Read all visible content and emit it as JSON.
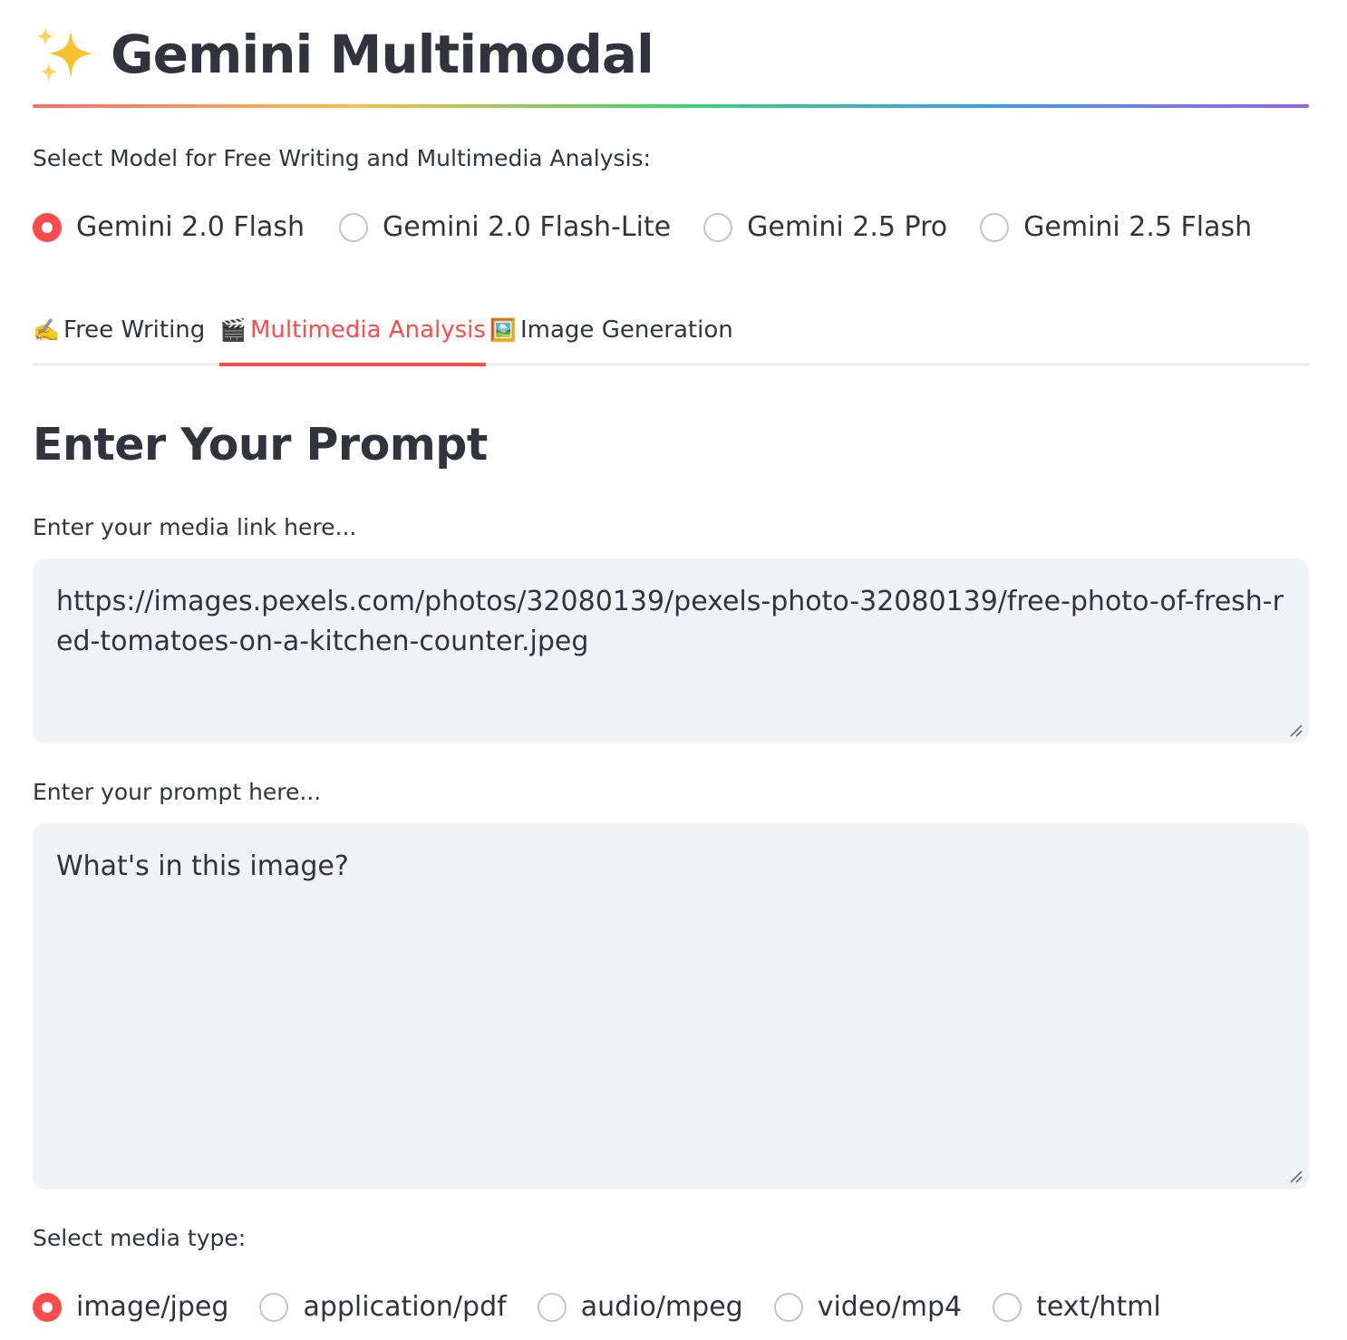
{
  "app": {
    "title": "Gemini Multimodal",
    "title_icon": "sparkles-icon"
  },
  "colors": {
    "accent": "#ff4b4b",
    "text": "#31333f",
    "input_bg": "#f0f2f6",
    "radio_border": "#c3c5ce",
    "divider_gradient": [
      "#ff6c6c",
      "#ffbd45",
      "#3dd56d",
      "#3d9df3",
      "#9a5dff"
    ]
  },
  "model_select": {
    "label": "Select Model for Free Writing and Multimedia Analysis:",
    "selected": "Gemini 2.0 Flash",
    "options": [
      {
        "label": "Gemini 2.0 Flash",
        "checked": true
      },
      {
        "label": "Gemini 2.0 Flash-Lite",
        "checked": false
      },
      {
        "label": "Gemini 2.5 Pro",
        "checked": false
      },
      {
        "label": "Gemini 2.5 Flash",
        "checked": false
      }
    ]
  },
  "tabs": [
    {
      "icon": "✍️",
      "icon_name": "writing-hand-icon",
      "label": "Free Writing",
      "active": false
    },
    {
      "icon": "🎬",
      "icon_name": "clapper-board-icon",
      "label": "Multimedia Analysis",
      "active": true
    },
    {
      "icon": "🖼️",
      "icon_name": "framed-picture-icon",
      "label": "Image Generation",
      "active": false
    }
  ],
  "main": {
    "heading": "Enter Your Prompt",
    "media_link": {
      "label": "Enter your media link here...",
      "value": "https://images.pexels.com/photos/32080139/pexels-photo-32080139/free-photo-of-fresh-red-tomatoes-on-a-kitchen-counter.jpeg"
    },
    "prompt": {
      "label": "Enter your prompt here...",
      "value": "What's in this image?"
    },
    "media_type": {
      "label": "Select media type:",
      "selected": "image/jpeg",
      "options": [
        {
          "label": "image/jpeg",
          "checked": true
        },
        {
          "label": "application/pdf",
          "checked": false
        },
        {
          "label": "audio/mpeg",
          "checked": false
        },
        {
          "label": "video/mp4",
          "checked": false
        },
        {
          "label": "text/html",
          "checked": false
        }
      ]
    }
  }
}
